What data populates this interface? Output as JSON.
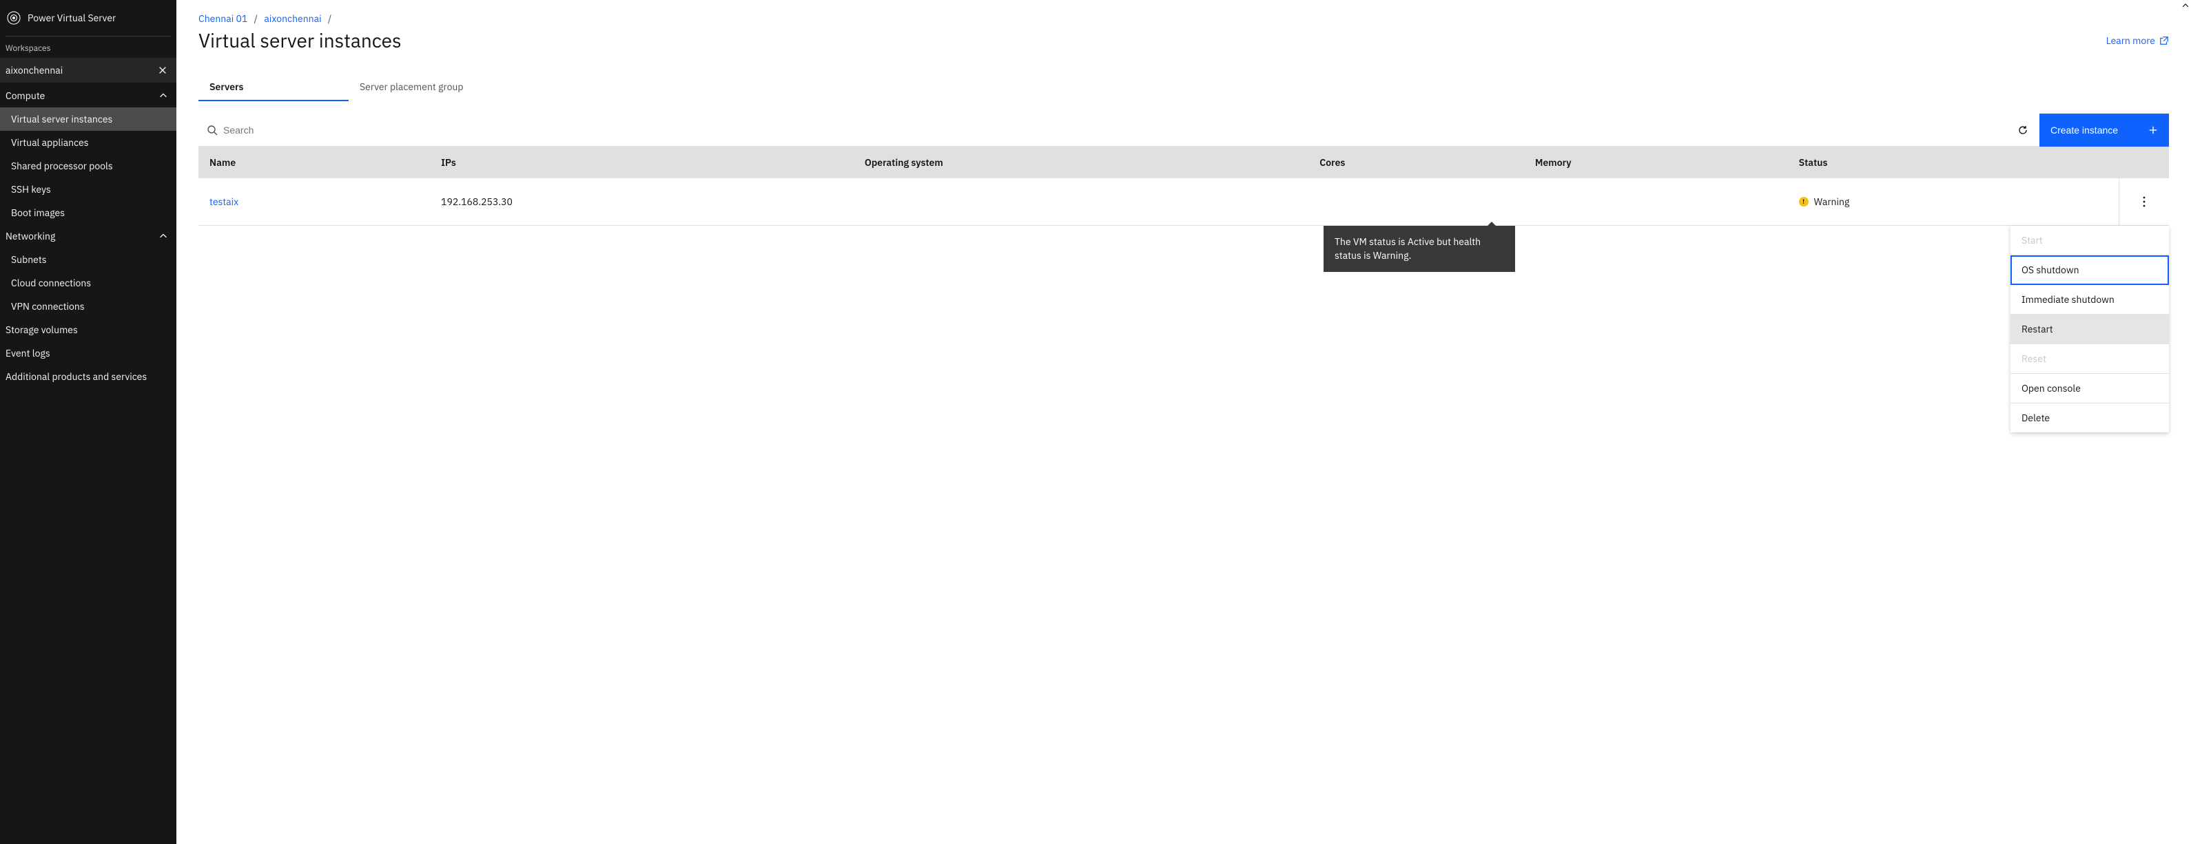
{
  "sidebar": {
    "product": "Power Virtual Server",
    "workspaces_label": "Workspaces",
    "workspace_selected": "aixonchennai",
    "groups": [
      {
        "label": "Compute",
        "expanded": true,
        "items": [
          {
            "label": "Virtual server instances",
            "selected": true
          },
          {
            "label": "Virtual appliances"
          },
          {
            "label": "Shared processor pools"
          },
          {
            "label": "SSH keys"
          },
          {
            "label": "Boot images"
          }
        ]
      },
      {
        "label": "Networking",
        "expanded": true,
        "items": [
          {
            "label": "Subnets"
          },
          {
            "label": "Cloud connections"
          },
          {
            "label": "VPN connections"
          }
        ]
      }
    ],
    "flat_items": [
      {
        "label": "Storage volumes"
      },
      {
        "label": "Event logs"
      },
      {
        "label": "Additional products and services"
      }
    ]
  },
  "breadcrumb": {
    "region": "Chennai 01",
    "workspace": "aixonchennai"
  },
  "page": {
    "title": "Virtual server instances",
    "learn_more": "Learn more"
  },
  "tabs": {
    "servers": "Servers",
    "placement": "Server placement group"
  },
  "toolbar": {
    "search_placeholder": "Search",
    "create_label": "Create instance"
  },
  "table": {
    "headers": {
      "name": "Name",
      "ips": "IPs",
      "os": "Operating system",
      "cores": "Cores",
      "memory": "Memory",
      "status": "Status"
    },
    "rows": [
      {
        "name": "testaix",
        "ip": "192.168.253.30",
        "os": "",
        "cores": "",
        "memory": "",
        "status": "Warning"
      }
    ]
  },
  "tooltip": "The VM status is Active but health status is Warning.",
  "menu": {
    "start": "Start",
    "os_shutdown": "OS shutdown",
    "immediate_shutdown": "Immediate shutdown",
    "restart": "Restart",
    "reset": "Reset",
    "open_console": "Open console",
    "delete": "Delete"
  }
}
